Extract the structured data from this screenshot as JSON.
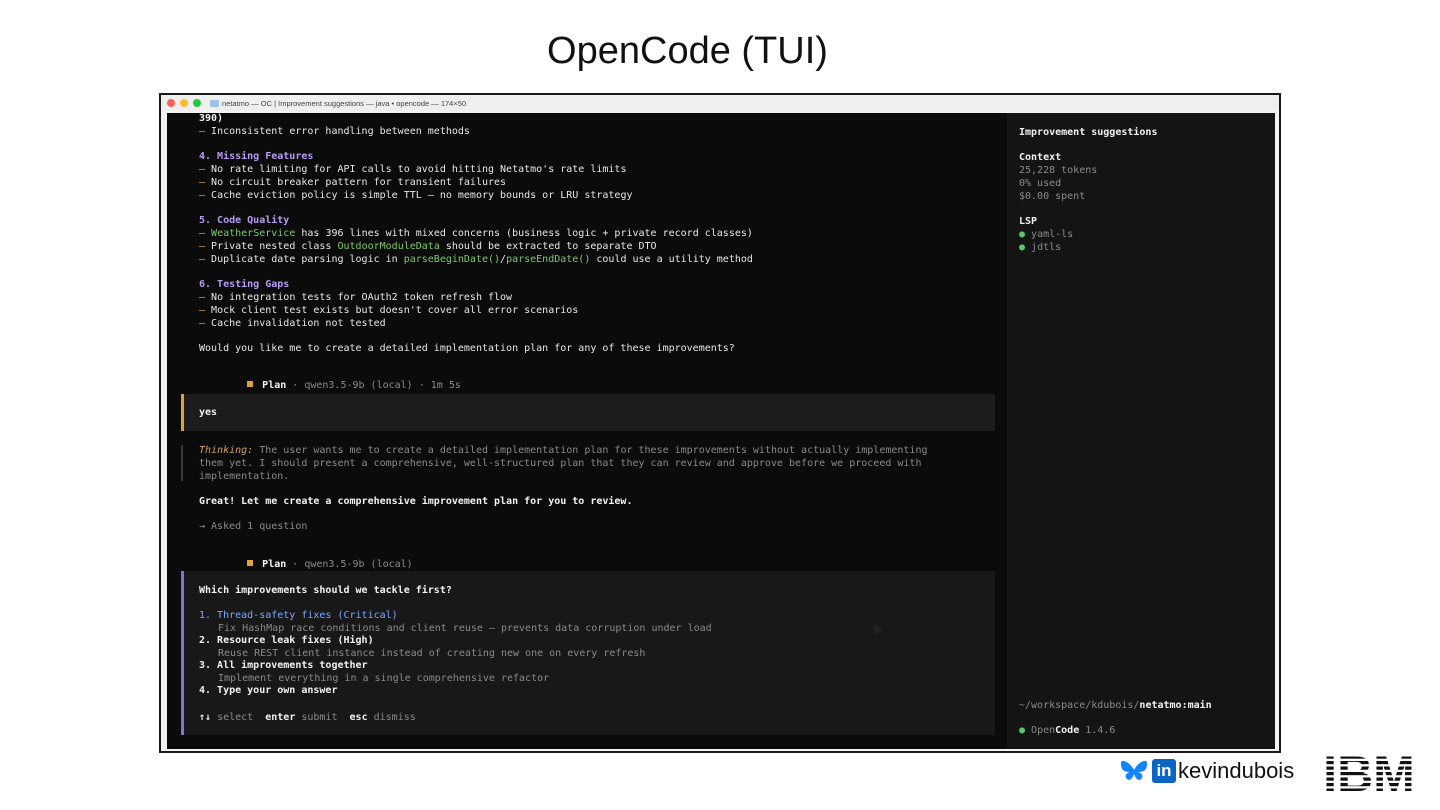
{
  "slide": {
    "title": "OpenCode (TUI)"
  },
  "window": {
    "title": "netatmo — OC | Improvement suggestions — java • opencode — 174×50"
  },
  "transcript": {
    "lines": [
      {
        "segs": [
          {
            "t": "390)",
            "c": "bold"
          }
        ]
      },
      {
        "segs": [
          {
            "t": "– ",
            "c": "orange"
          },
          {
            "t": "Inconsistent error handling between methods"
          }
        ]
      },
      {
        "segs": [
          {
            "t": "4. Missing Features",
            "c": "purple"
          }
        ]
      },
      {
        "segs": [
          {
            "t": "– ",
            "c": "orange"
          },
          {
            "t": "No rate limiting for API calls to avoid hitting Netatmo's rate limits"
          }
        ]
      },
      {
        "segs": [
          {
            "t": "– ",
            "c": "orange"
          },
          {
            "t": "No circuit breaker pattern for transient failures"
          }
        ]
      },
      {
        "segs": [
          {
            "t": "– ",
            "c": "orange"
          },
          {
            "t": "Cache eviction policy is simple TTL – no memory bounds or LRU strategy"
          }
        ]
      },
      {
        "segs": [
          {
            "t": "5. Code Quality",
            "c": "purple"
          }
        ]
      },
      {
        "segs": [
          {
            "t": "– ",
            "c": "orange"
          },
          {
            "t": "WeatherService",
            "c": "green"
          },
          {
            "t": " has 396 lines with mixed concerns (business logic + private record classes)"
          }
        ]
      },
      {
        "segs": [
          {
            "t": "– ",
            "c": "orange"
          },
          {
            "t": "Private nested class "
          },
          {
            "t": "OutdoorModuleData",
            "c": "green"
          },
          {
            "t": " should be extracted to separate DTO"
          }
        ]
      },
      {
        "segs": [
          {
            "t": "– ",
            "c": "orange"
          },
          {
            "t": "Duplicate date parsing logic in "
          },
          {
            "t": "parseBeginDate()",
            "c": "green"
          },
          {
            "t": "/"
          },
          {
            "t": "parseEndDate()",
            "c": "green"
          },
          {
            "t": " could use a utility method"
          }
        ]
      },
      {
        "segs": [
          {
            "t": "6. Testing Gaps",
            "c": "purple"
          }
        ]
      },
      {
        "segs": [
          {
            "t": "– ",
            "c": "orange"
          },
          {
            "t": "No integration tests for OAuth2 token refresh flow"
          }
        ]
      },
      {
        "segs": [
          {
            "t": "– ",
            "c": "orange"
          },
          {
            "t": "Mock client test exists but doesn't cover all error scenarios"
          }
        ]
      },
      {
        "segs": [
          {
            "t": "– ",
            "c": "orange"
          },
          {
            "t": "Cache invalidation not tested"
          }
        ]
      },
      {
        "segs": [
          {
            "t": "Would you like me to create a detailed implementation plan for any of these improvements?"
          }
        ]
      }
    ],
    "plan1": {
      "label": "Plan",
      "meta": " · qwen3.5-9b (local) · 1m 5s"
    },
    "user_message": "yes",
    "thinking": {
      "label": "Thinking:",
      "lines": [
        " The user wants me to create a detailed implementation plan for these improvements without actually implementing",
        "them yet. I should present a comprehensive, well-structured plan that they can review and approve before we proceed with",
        "implementation."
      ]
    },
    "reply": "Great! Let me create a comprehensive improvement plan for you to review.",
    "asked": "→ Asked 1 question",
    "plan2": {
      "label": "Plan",
      "meta": " · qwen3.5-9b (local)"
    }
  },
  "question": {
    "prompt": "Which improvements should we tackle first?",
    "options": [
      {
        "label": "1. Thread-safety fixes (Critical)",
        "desc": "Fix HashMap race conditions and client reuse – prevents data corruption under load",
        "selected": true
      },
      {
        "label": "2. Resource leak fixes (High)",
        "desc": "Reuse REST client instance instead of creating new one on every refresh",
        "selected": false
      },
      {
        "label": "3. All improvements together",
        "desc": "Implement everything in a single comprehensive refactor",
        "selected": false
      },
      {
        "label": "4. Type your own answer",
        "desc": "",
        "selected": false
      }
    ],
    "hints": {
      "arrows": "↑↓",
      "select": " select  ",
      "enter": "enter",
      "submit": " submit  ",
      "esc": "esc",
      "dismiss": " dismiss"
    }
  },
  "sidebar": {
    "title": "Improvement suggestions",
    "context_label": "Context",
    "tokens": "25,228 tokens",
    "used": "0% used",
    "spent": "$0.00 spent",
    "lsp_label": "LSP",
    "lsp_items": [
      "yaml-ls",
      "jdtls"
    ],
    "path_prefix": "~/workspace/kdubois/",
    "path_repo": "netatmo:main",
    "app_open": "Open",
    "app_code": "Code",
    "version": "1.4.6"
  },
  "footer": {
    "handle": "kevindubois",
    "linkedin_text": "in",
    "ibm_text": "IBM"
  }
}
